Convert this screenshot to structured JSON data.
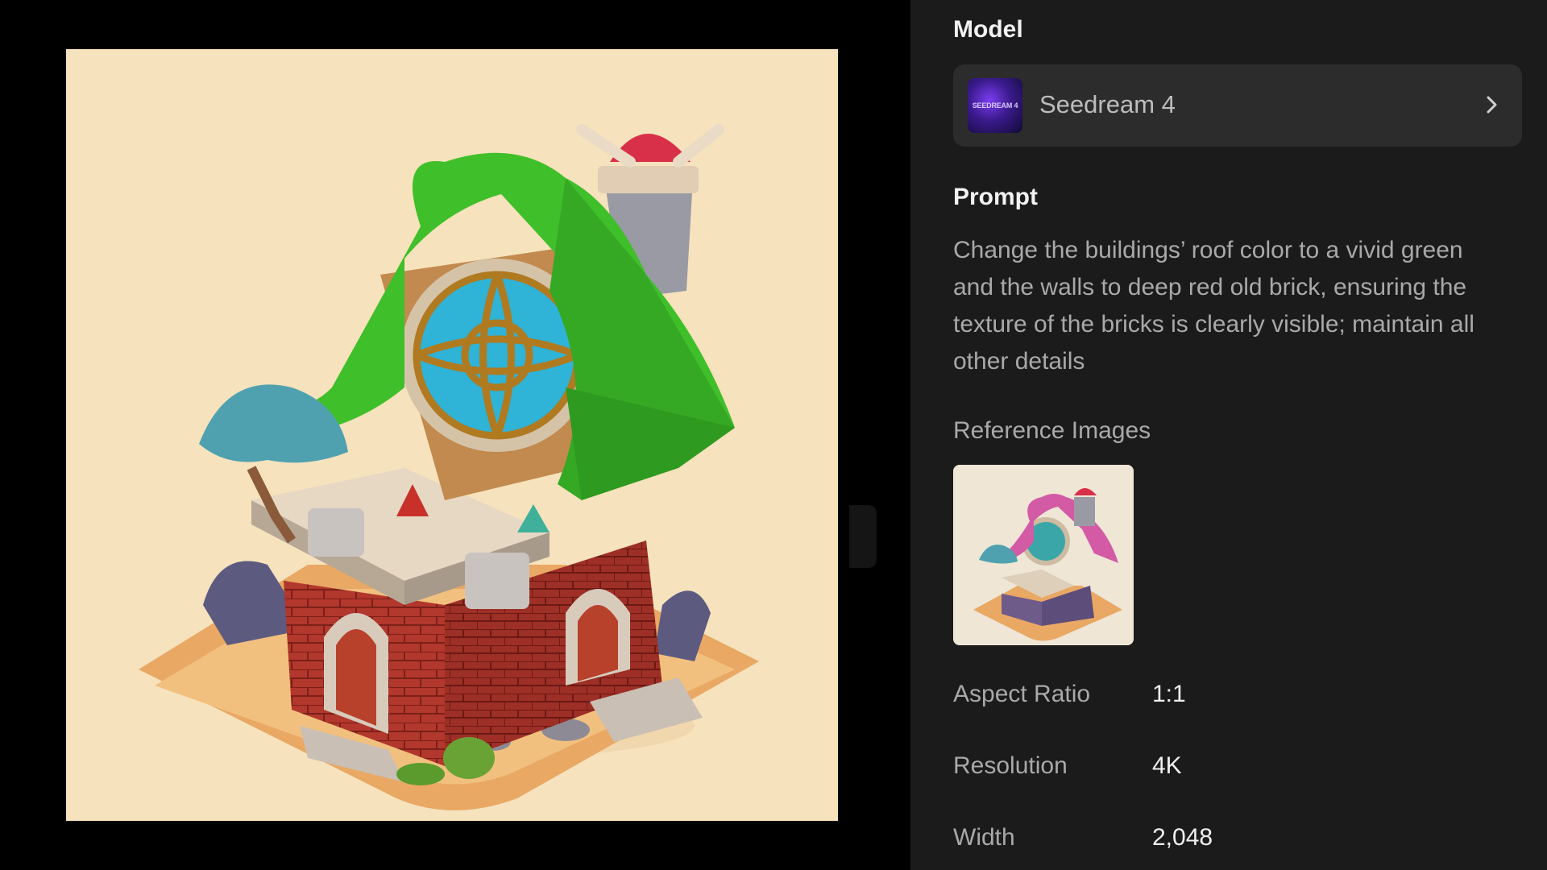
{
  "sidebar": {
    "model_heading": "Model",
    "model": {
      "name": "Seedream 4",
      "thumb_label": "SEEDREAM 4",
      "thumb_icon": "seedream-logo",
      "chevron_icon": "chevron-right-icon"
    },
    "prompt_heading": "Prompt",
    "prompt_text": "Change the buildings’ roof color to a vivid green and the walls to deep red old brick, ensuring the texture of the bricks is clearly visible; maintain all other details",
    "reference_heading": "Reference Images",
    "properties": [
      {
        "label": "Aspect Ratio",
        "value": "1:1"
      },
      {
        "label": "Resolution",
        "value": "4K"
      },
      {
        "label": "Width",
        "value": "2,048"
      }
    ]
  },
  "colors": {
    "sidebar_bg": "#1b1b1b",
    "card_bg": "#2c2c2c",
    "roof_green": "#3fbf2a",
    "brick_red": "#b03a2e",
    "sand": "#f6e2bc"
  }
}
